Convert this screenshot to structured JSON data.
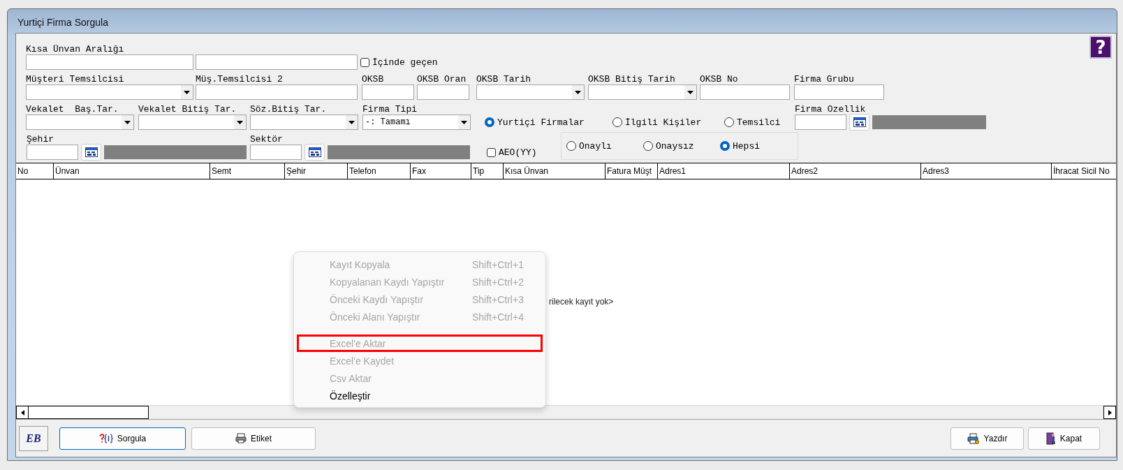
{
  "window": {
    "title": "Yurtiçi Firma Sorgula"
  },
  "form": {
    "help": "?",
    "fields": [
      {
        "kind": "text",
        "label": "Kısa Ünvan Aralığı"
      },
      {
        "kind": "text"
      },
      {
        "kind": "check",
        "label": "İçinde geçen",
        "checked": false
      },
      {
        "kind": "combo",
        "label": "Müşteri Temsilcisi"
      },
      {
        "kind": "text",
        "label": "Müş.Temsilcisi 2"
      },
      {
        "kind": "text",
        "label": "OKSB"
      },
      {
        "kind": "text",
        "label": "OKSB Oran"
      },
      {
        "kind": "combo",
        "label": "OKSB Tarih"
      },
      {
        "kind": "combo",
        "label": "OKSB Bitiş Tarih"
      },
      {
        "kind": "text",
        "label": "OKSB No"
      },
      {
        "kind": "text",
        "label": "Firma Grubu"
      },
      {
        "kind": "combo",
        "label": "Vekalet  Baş.Tar."
      },
      {
        "kind": "combo",
        "label": "Vekalet Bitiş Tar."
      },
      {
        "kind": "combo",
        "label": "Söz.Bitiş Tar."
      },
      {
        "kind": "combo",
        "label": "Firma Tipi",
        "value": "-: Tamamı"
      },
      {
        "kind": "radio",
        "label": "Yurtiçi Firmalar",
        "selected": true
      },
      {
        "kind": "radio",
        "label": "İlgili Kişiler",
        "selected": false
      },
      {
        "kind": "radio",
        "label": "Temsilci",
        "selected": false
      },
      {
        "kind": "lookup",
        "label": "Firma Ozellik"
      },
      {
        "kind": "lookup",
        "label": "Şehir"
      },
      {
        "kind": "lookup",
        "label": "Sektör"
      },
      {
        "kind": "check",
        "label": "AEO(YY)",
        "checked": false
      },
      {
        "kind": "radio_group",
        "options": [
          {
            "label": "Onaylı",
            "selected": false
          },
          {
            "label": "Onaysız",
            "selected": false
          },
          {
            "label": "Hepsi",
            "selected": true
          }
        ]
      }
    ]
  },
  "table": {
    "columns": [
      "No",
      "Ünvan",
      "Semt",
      "Şehir",
      "Telefon",
      "Fax",
      "Tip",
      "Kısa Ünvan",
      "Fatura Müşt",
      "Adres1",
      "Adres2",
      "Adres3",
      "İhracat Sicil No"
    ],
    "empty_message": "rilecek kayıt yok>"
  },
  "context_menu": {
    "items": [
      {
        "kind": "item",
        "label": "Kayıt Kopyala",
        "shortcut": "Shift+Ctrl+1",
        "disabled": true,
        "highlighted": false
      },
      {
        "kind": "item",
        "label": "Kopyalanan Kaydı Yapıştır",
        "shortcut": "Shift+Ctrl+2",
        "disabled": true,
        "highlighted": false
      },
      {
        "kind": "item",
        "label": "Önceki Kaydı Yapıştır",
        "shortcut": "Shift+Ctrl+3",
        "disabled": true,
        "highlighted": false
      },
      {
        "kind": "item",
        "label": "Önceki Alanı Yapıştır",
        "shortcut": "Shift+Ctrl+4",
        "disabled": true,
        "highlighted": false
      },
      {
        "kind": "separator"
      },
      {
        "kind": "item",
        "label": "Excel'e Aktar",
        "disabled": true,
        "highlighted": true
      },
      {
        "kind": "item",
        "label": "Excel'e Kaydet",
        "disabled": true,
        "highlighted": false
      },
      {
        "kind": "item",
        "label": "Csv Aktar",
        "disabled": true,
        "highlighted": false
      },
      {
        "kind": "item",
        "label": "Özelleştir",
        "disabled": false,
        "highlighted": false
      }
    ]
  },
  "footer": {
    "logo": "EB",
    "buttons": [
      {
        "kind": "query",
        "label": "Sorgula",
        "focused": true
      },
      {
        "kind": "label",
        "label": "Etiket",
        "focused": false
      },
      {
        "kind": "print",
        "label": "Yazdır",
        "focused": false
      },
      {
        "kind": "close",
        "label": "Kapat",
        "focused": false
      }
    ]
  }
}
